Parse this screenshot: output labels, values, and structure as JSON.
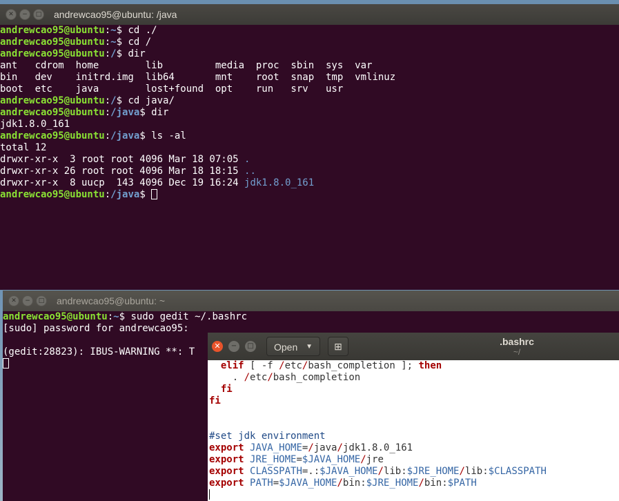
{
  "term1": {
    "title": "andrewcao95@ubuntu: /java",
    "lines": [
      [
        [
          "u",
          "andrewcao95@ubuntu"
        ],
        [
          "t",
          ":"
        ],
        [
          "p",
          "~"
        ],
        [
          "t",
          "$ cd ./"
        ]
      ],
      [
        [
          "u",
          "andrewcao95@ubuntu"
        ],
        [
          "t",
          ":"
        ],
        [
          "p",
          "~"
        ],
        [
          "t",
          "$ cd /"
        ]
      ],
      [
        [
          "u",
          "andrewcao95@ubuntu"
        ],
        [
          "t",
          ":"
        ],
        [
          "p",
          "/"
        ],
        [
          "t",
          "$ dir"
        ]
      ],
      [
        [
          "t",
          "ant   cdrom  home        lib         media  proc  sbin  sys  var"
        ]
      ],
      [
        [
          "t",
          "bin   dev    initrd.img  lib64       mnt    root  snap  tmp  vmlinuz"
        ]
      ],
      [
        [
          "t",
          "boot  etc    java        lost+found  opt    run   srv   usr"
        ]
      ],
      [
        [
          "u",
          "andrewcao95@ubuntu"
        ],
        [
          "t",
          ":"
        ],
        [
          "p",
          "/"
        ],
        [
          "t",
          "$ cd java/"
        ]
      ],
      [
        [
          "u",
          "andrewcao95@ubuntu"
        ],
        [
          "t",
          ":"
        ],
        [
          "p",
          "/java"
        ],
        [
          "t",
          "$ dir"
        ]
      ],
      [
        [
          "t",
          "jdk1.8.0_161"
        ]
      ],
      [
        [
          "u",
          "andrewcao95@ubuntu"
        ],
        [
          "t",
          ":"
        ],
        [
          "p",
          "/java"
        ],
        [
          "t",
          "$ ls -al"
        ]
      ],
      [
        [
          "t",
          "total 12"
        ]
      ],
      [
        [
          "t",
          "drwxr-xr-x  3 root root 4096 Mar 18 07:05 "
        ],
        [
          "d",
          "."
        ]
      ],
      [
        [
          "t",
          "drwxr-xr-x 26 root root 4096 Mar 18 18:15 "
        ],
        [
          "d",
          ".."
        ]
      ],
      [
        [
          "t",
          "drwxr-xr-x  8 uucp  143 4096 Dec 19 16:24 "
        ],
        [
          "d",
          "jdk1.8.0_161"
        ]
      ],
      [
        [
          "u",
          "andrewcao95@ubuntu"
        ],
        [
          "t",
          ":"
        ],
        [
          "p",
          "/java"
        ],
        [
          "t",
          "$ "
        ],
        [
          "c",
          ""
        ]
      ]
    ]
  },
  "term2": {
    "title": "andrewcao95@ubuntu: ~",
    "lines": [
      [
        [
          "u",
          "andrewcao95@ubuntu"
        ],
        [
          "t",
          ":"
        ],
        [
          "p",
          "~"
        ],
        [
          "t",
          "$ sudo gedit ~/.bashrc"
        ]
      ],
      [
        [
          "t",
          "[sudo] password for andrewcao95:"
        ]
      ],
      [
        [
          "t",
          ""
        ]
      ],
      [
        [
          "t",
          "(gedit:28823): IBUS-WARNING **: T"
        ]
      ],
      [
        [
          "c",
          ""
        ]
      ]
    ]
  },
  "gedit": {
    "open_label": "Open",
    "title": ".bashrc",
    "subtitle": "~/",
    "lines": [
      [
        [
          "t",
          "  "
        ],
        [
          "kw",
          "elif"
        ],
        [
          "t",
          " [ -f "
        ],
        [
          "sl",
          "/"
        ],
        [
          "t",
          "etc"
        ],
        [
          "sl",
          "/"
        ],
        [
          "t",
          "bash_completion ]; "
        ],
        [
          "kw",
          "then"
        ]
      ],
      [
        [
          "t",
          "    . "
        ],
        [
          "sl",
          "/"
        ],
        [
          "t",
          "etc"
        ],
        [
          "sl",
          "/"
        ],
        [
          "t",
          "bash_completion"
        ]
      ],
      [
        [
          "t",
          "  "
        ],
        [
          "kw",
          "fi"
        ]
      ],
      [
        [
          "kw",
          "fi"
        ]
      ],
      [
        [
          "t",
          ""
        ]
      ],
      [
        [
          "t",
          ""
        ]
      ],
      [
        [
          "cm",
          "#set jdk environment"
        ]
      ],
      [
        [
          "kw",
          "export"
        ],
        [
          "t",
          " "
        ],
        [
          "vr",
          "JAVA_HOME"
        ],
        [
          "t",
          "="
        ],
        [
          "sl",
          "/"
        ],
        [
          "t",
          "java"
        ],
        [
          "sl",
          "/"
        ],
        [
          "t",
          "jdk1.8.0_161"
        ]
      ],
      [
        [
          "kw",
          "export"
        ],
        [
          "t",
          " "
        ],
        [
          "vr",
          "JRE_HOME"
        ],
        [
          "t",
          "="
        ],
        [
          "vr",
          "$JAVA_HOME"
        ],
        [
          "sl",
          "/"
        ],
        [
          "t",
          "jre"
        ]
      ],
      [
        [
          "kw",
          "export"
        ],
        [
          "t",
          " "
        ],
        [
          "vr",
          "CLASSPATH"
        ],
        [
          "t",
          "=.:"
        ],
        [
          "vr",
          "$JAVA_HOME"
        ],
        [
          "sl",
          "/"
        ],
        [
          "t",
          "lib:"
        ],
        [
          "vr",
          "$JRE_HOME"
        ],
        [
          "sl",
          "/"
        ],
        [
          "t",
          "lib:"
        ],
        [
          "vr",
          "$CLASSPATH"
        ]
      ],
      [
        [
          "kw",
          "export"
        ],
        [
          "t",
          " "
        ],
        [
          "vr",
          "PATH"
        ],
        [
          "t",
          "="
        ],
        [
          "vr",
          "$JAVA_HOME"
        ],
        [
          "sl",
          "/"
        ],
        [
          "t",
          "bin:"
        ],
        [
          "vr",
          "$JRE_HOME"
        ],
        [
          "sl",
          "/"
        ],
        [
          "t",
          "bin:"
        ],
        [
          "vr",
          "$PATH"
        ]
      ],
      [
        [
          "ec",
          ""
        ]
      ]
    ]
  }
}
